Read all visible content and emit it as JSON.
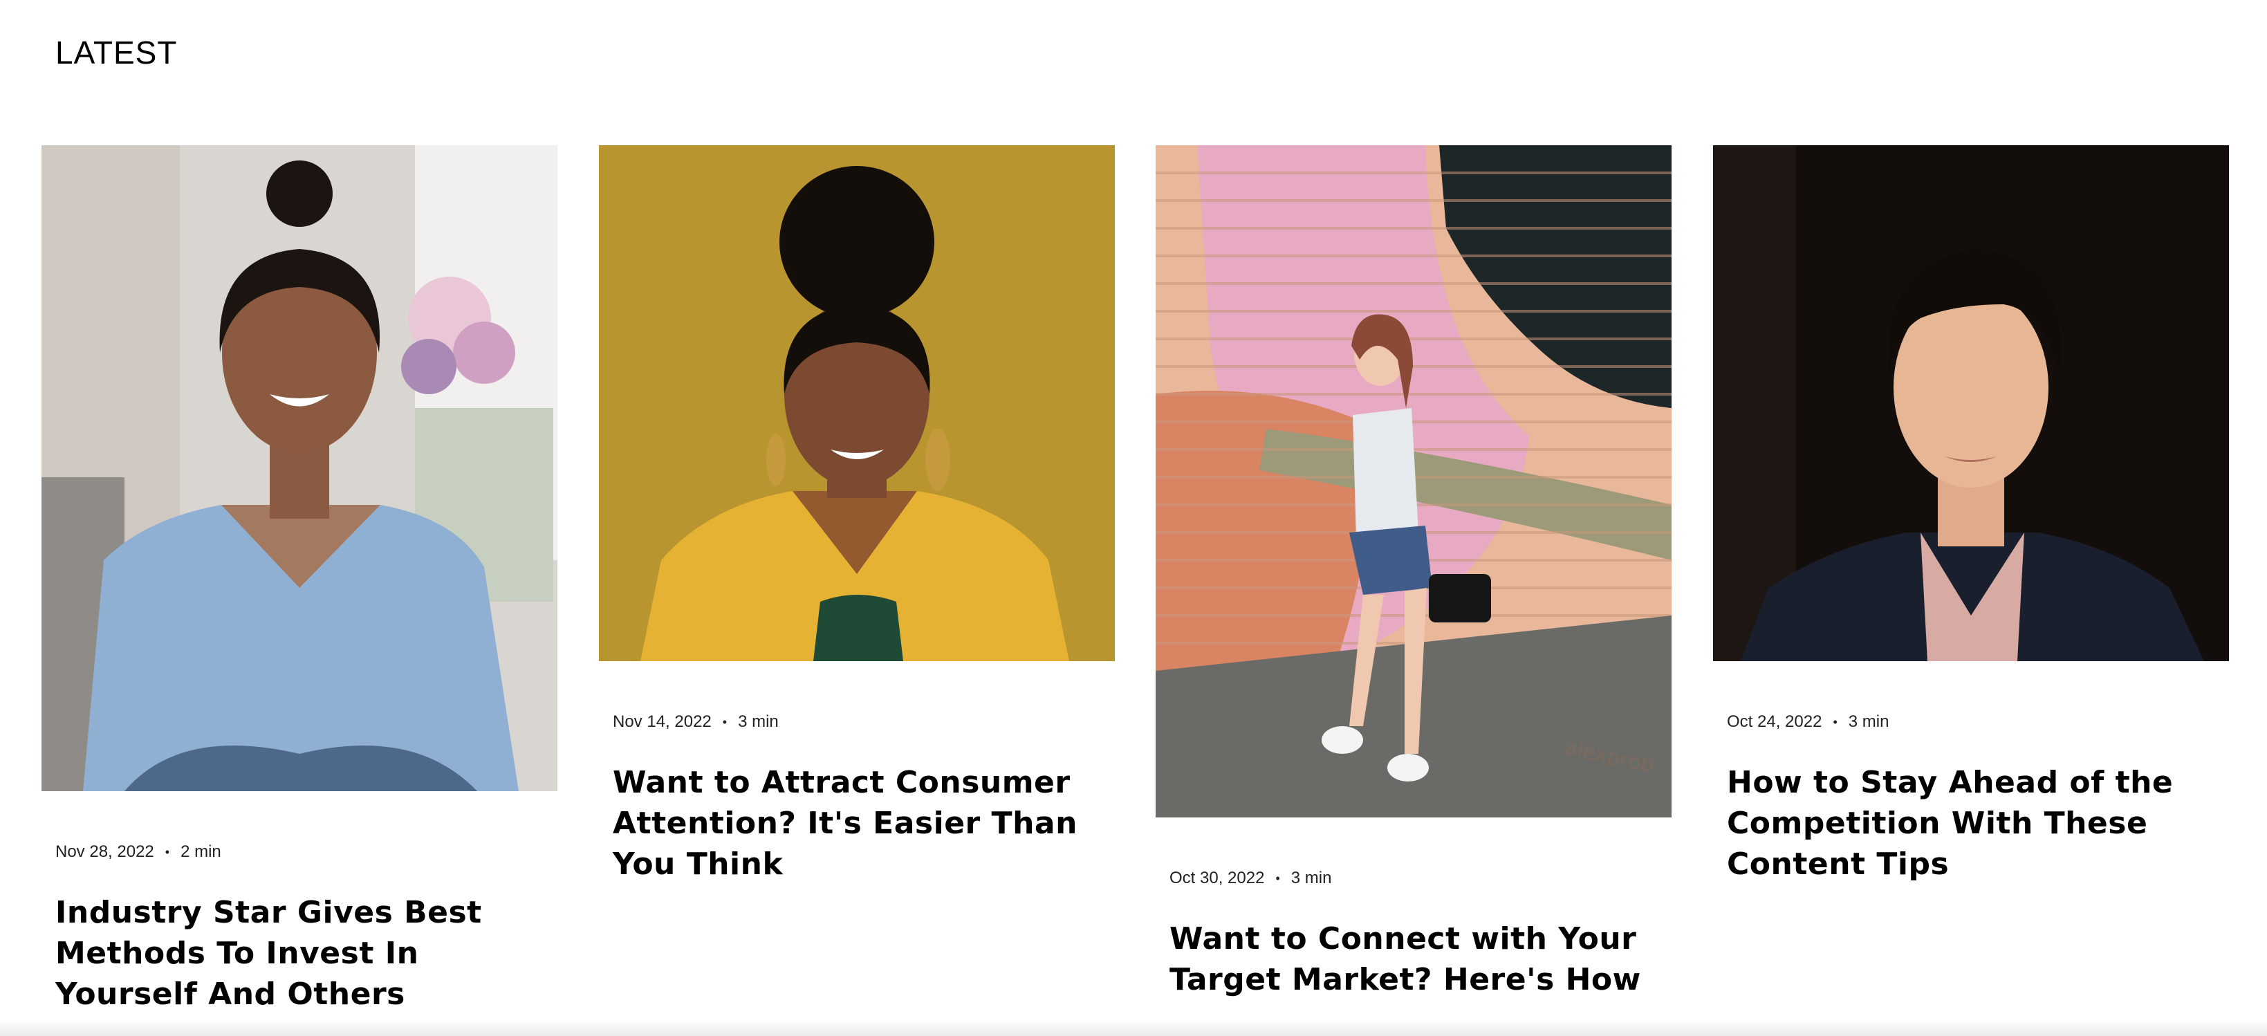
{
  "section": {
    "title": "LATEST"
  },
  "posts": [
    {
      "date": "Nov 28, 2022",
      "separator": "•",
      "read_time": "2 min",
      "title": "Industry Star Gives Best Methods To Invest In Yourself And Others",
      "image": "portrait-woman-denim-shirt"
    },
    {
      "date": "Nov 14, 2022",
      "separator": "•",
      "read_time": "3 min",
      "title": "Want to Attract Consumer Attention? It's Easier Than You Think",
      "image": "portrait-woman-yellow-blazer"
    },
    {
      "date": "Oct 30, 2022",
      "separator": "•",
      "read_time": "3 min",
      "title": "Want to Connect with Your Target Market? Here's How",
      "image": "woman-mural-wall",
      "watermark": "alexprob"
    },
    {
      "date": "Oct 24, 2022",
      "separator": "•",
      "read_time": "3 min",
      "title": "How to Stay Ahead of the Competition With These Content Tips",
      "image": "portrait-man-dark-background"
    }
  ],
  "colors": {
    "text": "#000000",
    "meta_text": "#222222",
    "background": "#ffffff"
  }
}
